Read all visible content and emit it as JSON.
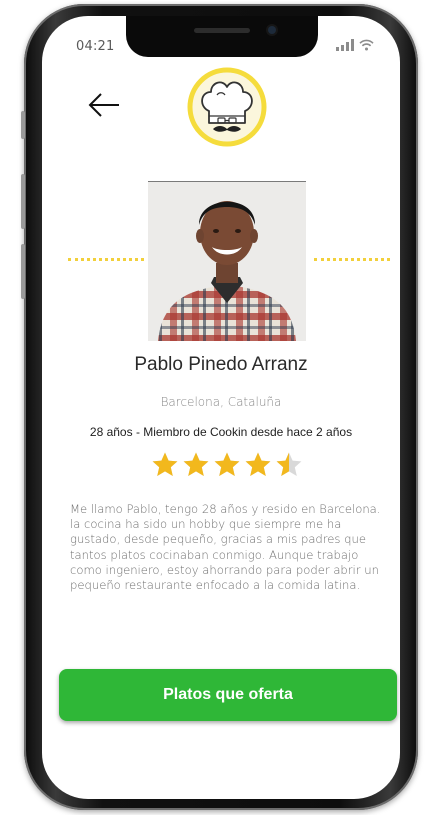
{
  "status_bar": {
    "time": "04:21",
    "signal_icon": "signal-icon",
    "wifi_icon": "wifi-icon"
  },
  "header": {
    "back_icon": "arrow-left-icon",
    "logo": "chef-hat-mustache-logo"
  },
  "profile": {
    "name": "Pablo Pinedo Arranz",
    "location": "Barcelona, Cataluña",
    "membership": "28 años - Miembro de Cookin desde hace 2 años",
    "rating": 4.5,
    "rating_max": 5,
    "bio": "Me llamo Pablo, tengo 28 años y resido en Barcelona. la cocina ha sido un hobby que siempre me ha gustado, desde pequeño, gracias a mis padres que tantos platos cocinaban conmigo. Aunque trabajo como ingeniero, estoy ahorrando para poder abrir un pequeño restaurante enfocado a la comida latina."
  },
  "actions": {
    "offers_button_label": "Platos que oferta"
  },
  "colors": {
    "accent_green": "#2fb737",
    "star_gold": "#f2b81d",
    "logo_ring": "#f5dc3c",
    "dots_yellow": "#f2d03b"
  }
}
